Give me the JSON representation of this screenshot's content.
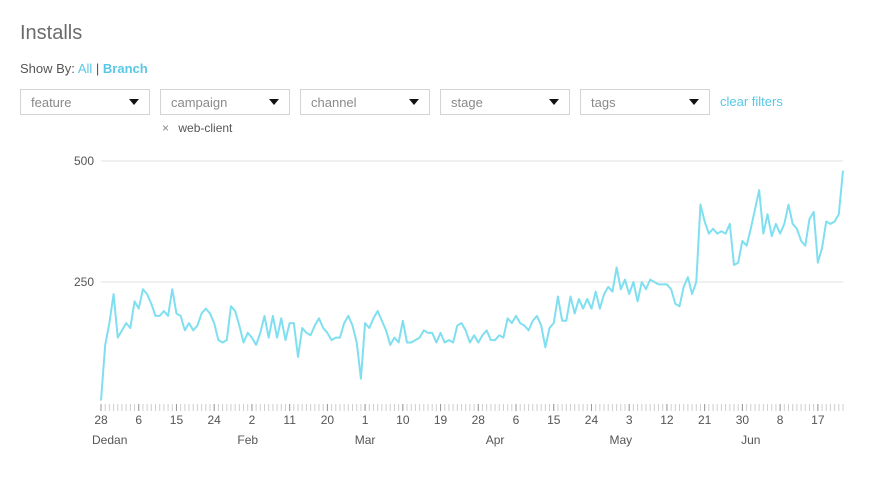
{
  "page": {
    "title": "Installs",
    "show_by_label": "Show By:",
    "show_by_all": "All",
    "show_by_separator": "|",
    "show_by_branch": "Branch",
    "filters": [
      "feature",
      "campaign",
      "channel",
      "stage",
      "tags"
    ],
    "clear_filters": "clear filters",
    "active_filter": "web-client",
    "active_filter_remove": "×"
  },
  "colors": {
    "accent": "#58c8e6",
    "line": "#7fdff0",
    "grid": "#e2e2e2"
  },
  "chart_data": {
    "type": "line",
    "ylim": [
      0,
      500
    ],
    "y_ticks": [
      "500",
      "250"
    ],
    "y_tick_values": [
      500,
      250
    ],
    "x_tick_labels": [
      "28",
      "6",
      "15",
      "24",
      "2",
      "11",
      "20",
      "1",
      "10",
      "19",
      "28",
      "6",
      "15",
      "24",
      "3",
      "12",
      "21",
      "30",
      "8",
      "17"
    ],
    "x_tick_index": [
      0,
      9,
      18,
      27,
      36,
      45,
      54,
      63,
      72,
      81,
      90,
      99,
      108,
      117,
      126,
      135,
      144,
      153,
      162,
      171
    ],
    "month_labels": [
      "Dedan",
      "Feb",
      "Mar",
      "Apr",
      "May",
      "Jun"
    ],
    "month_label_index": [
      0,
      35,
      63,
      94,
      124,
      155
    ],
    "series": [
      {
        "values": [
          5,
          120,
          165,
          225,
          135,
          150,
          165,
          155,
          210,
          195,
          235,
          225,
          205,
          180,
          180,
          190,
          180,
          235,
          185,
          180,
          150,
          165,
          150,
          160,
          185,
          195,
          185,
          165,
          130,
          125,
          130,
          200,
          190,
          160,
          125,
          145,
          135,
          120,
          145,
          180,
          135,
          180,
          135,
          175,
          130,
          165,
          165,
          95,
          155,
          145,
          140,
          160,
          175,
          155,
          145,
          130,
          135,
          135,
          165,
          180,
          160,
          125,
          50,
          165,
          155,
          175,
          190,
          170,
          150,
          120,
          135,
          125,
          170,
          125,
          125,
          130,
          135,
          150,
          145,
          145,
          125,
          145,
          125,
          130,
          125,
          160,
          165,
          150,
          125,
          140,
          125,
          140,
          150,
          130,
          130,
          140,
          135,
          175,
          165,
          180,
          165,
          160,
          150,
          170,
          180,
          160,
          115,
          155,
          165,
          220,
          170,
          170,
          220,
          185,
          215,
          195,
          215,
          195,
          230,
          195,
          225,
          240,
          230,
          280,
          235,
          255,
          225,
          250,
          210,
          250,
          235,
          255,
          250,
          245,
          245,
          245,
          235,
          205,
          200,
          240,
          260,
          225,
          250,
          410,
          375,
          350,
          360,
          350,
          355,
          350,
          370,
          285,
          290,
          335,
          325,
          360,
          400,
          440,
          350,
          390,
          345,
          370,
          350,
          370,
          410,
          370,
          360,
          335,
          325,
          380,
          395,
          290,
          320,
          375,
          370,
          375,
          390,
          480
        ]
      }
    ]
  }
}
